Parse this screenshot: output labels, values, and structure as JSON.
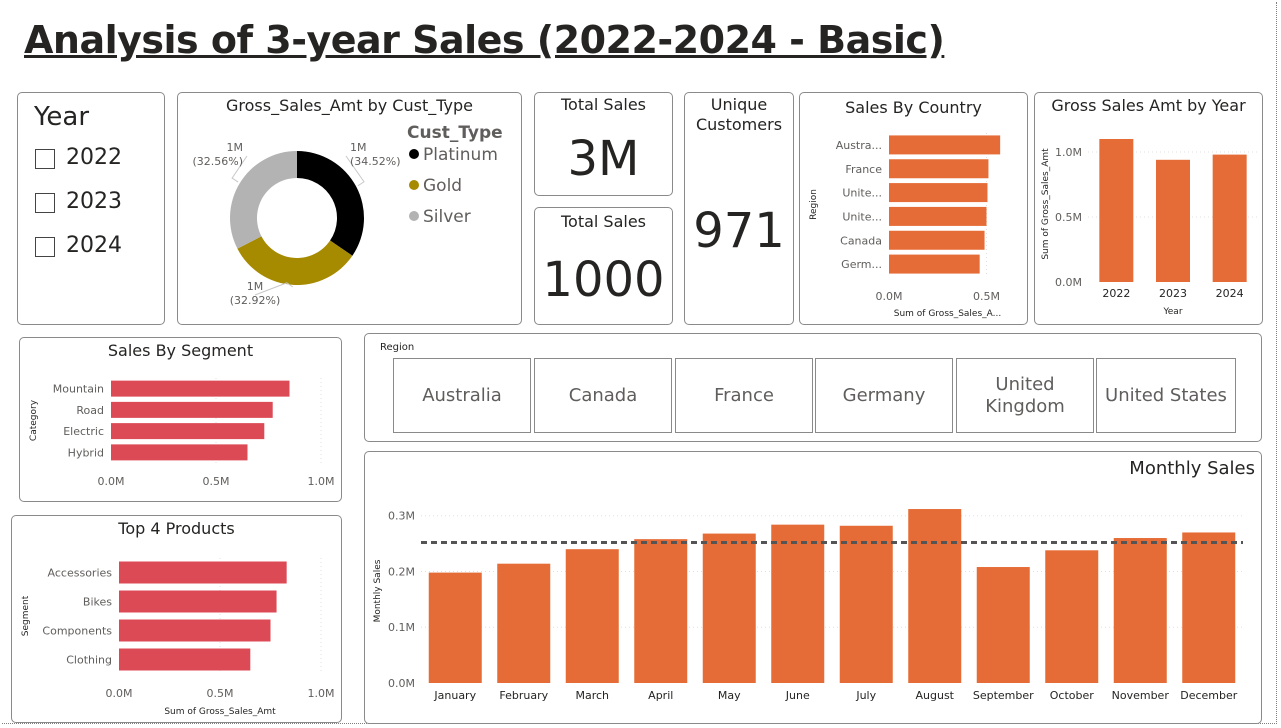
{
  "report": {
    "title": "Analysis of 3-year Sales (2022-2024 - Basic)"
  },
  "colors": {
    "orange": "#e66c37",
    "red": "#dc4a56",
    "black": "#000000",
    "gold": "#a68a00",
    "silver": "#b3b3b3",
    "avg_line": "#555555"
  },
  "year_slicer": {
    "title": "Year",
    "options": [
      "2022",
      "2023",
      "2024"
    ]
  },
  "kpis": {
    "total_sales_1": {
      "label": "Total Sales",
      "value": "3M"
    },
    "total_sales_2": {
      "label": "Total Sales",
      "value": "1000"
    },
    "unique_customers": {
      "label": "Unique Customers",
      "value": "971"
    }
  },
  "region_slicer": {
    "title": "Region",
    "options": [
      "Australia",
      "Canada",
      "France",
      "Germany",
      "United Kingdom",
      "United States"
    ]
  },
  "chart_data": [
    {
      "id": "cust_type",
      "type": "pie",
      "title": "Gross_Sales_Amt by Cust_Type",
      "legend_title": "Cust_Type",
      "legend_position": "right",
      "slices": [
        {
          "name": "Platinum",
          "value_label": "1M",
          "percent": 34.52,
          "percent_label": "(34.52%)",
          "color": "#000000"
        },
        {
          "name": "Gold",
          "value_label": "1M",
          "percent": 32.92,
          "percent_label": "(32.92%)",
          "color": "#a68a00"
        },
        {
          "name": "Silver",
          "value_label": "1M",
          "percent": 32.56,
          "percent_label": "(32.56%)",
          "color": "#b3b3b3"
        }
      ]
    },
    {
      "id": "country",
      "type": "bar",
      "orientation": "horizontal",
      "title": "Sales By Country",
      "ylabel": "Region",
      "xlabel": "Sum of Gross_Sales_A...",
      "categories": [
        "Austra...",
        "France",
        "Unite...",
        "Unite...",
        "Canada",
        "Germ..."
      ],
      "values": [
        0.57,
        0.51,
        0.505,
        0.5,
        0.49,
        0.465
      ],
      "xticks": [
        "0.0M",
        "0.5M"
      ],
      "xlim": [
        0,
        0.6
      ],
      "color": "#e66c37"
    },
    {
      "id": "year",
      "type": "bar",
      "title": "Gross Sales Amt by Year",
      "xlabel": "Year",
      "ylabel": "Sum of Gross_Sales_Amt",
      "categories": [
        "2022",
        "2023",
        "2024"
      ],
      "values": [
        1.1,
        0.94,
        0.98
      ],
      "yticks": [
        "0.0M",
        "0.5M",
        "1.0M"
      ],
      "ylim": [
        0,
        1.2
      ],
      "color": "#e66c37"
    },
    {
      "id": "segment",
      "type": "bar",
      "orientation": "horizontal",
      "title": "Sales By Segment",
      "ylabel": "Category",
      "xlabel": "",
      "categories": [
        "Mountain",
        "Road",
        "Electric",
        "Hybrid"
      ],
      "values": [
        0.85,
        0.77,
        0.73,
        0.65
      ],
      "xticks": [
        "0.0M",
        "0.5M",
        "1.0M"
      ],
      "xlim": [
        0,
        1.0
      ],
      "color": "#dc4a56"
    },
    {
      "id": "products",
      "type": "bar",
      "orientation": "horizontal",
      "title": "Top 4 Products",
      "ylabel": "Segment",
      "xlabel": "Sum of Gross_Sales_Amt",
      "categories": [
        "Accessories",
        "Bikes",
        "Components",
        "Clothing"
      ],
      "values": [
        0.83,
        0.78,
        0.75,
        0.65
      ],
      "xticks": [
        "0.0M",
        "0.5M",
        "1.0M"
      ],
      "xlim": [
        0,
        1.0
      ],
      "color": "#dc4a56"
    },
    {
      "id": "monthly",
      "type": "bar",
      "title": "Monthly Sales",
      "ylabel": "Monthly Sales",
      "xlabel": "",
      "categories": [
        "January",
        "February",
        "March",
        "April",
        "May",
        "June",
        "July",
        "August",
        "September",
        "October",
        "November",
        "December"
      ],
      "values": [
        0.198,
        0.214,
        0.24,
        0.258,
        0.268,
        0.284,
        0.282,
        0.312,
        0.208,
        0.238,
        0.26,
        0.27
      ],
      "average_line": 0.252,
      "yticks": [
        "0.0M",
        "0.1M",
        "0.2M",
        "0.3M"
      ],
      "ylim": [
        0,
        0.33
      ],
      "color": "#e66c37"
    }
  ]
}
